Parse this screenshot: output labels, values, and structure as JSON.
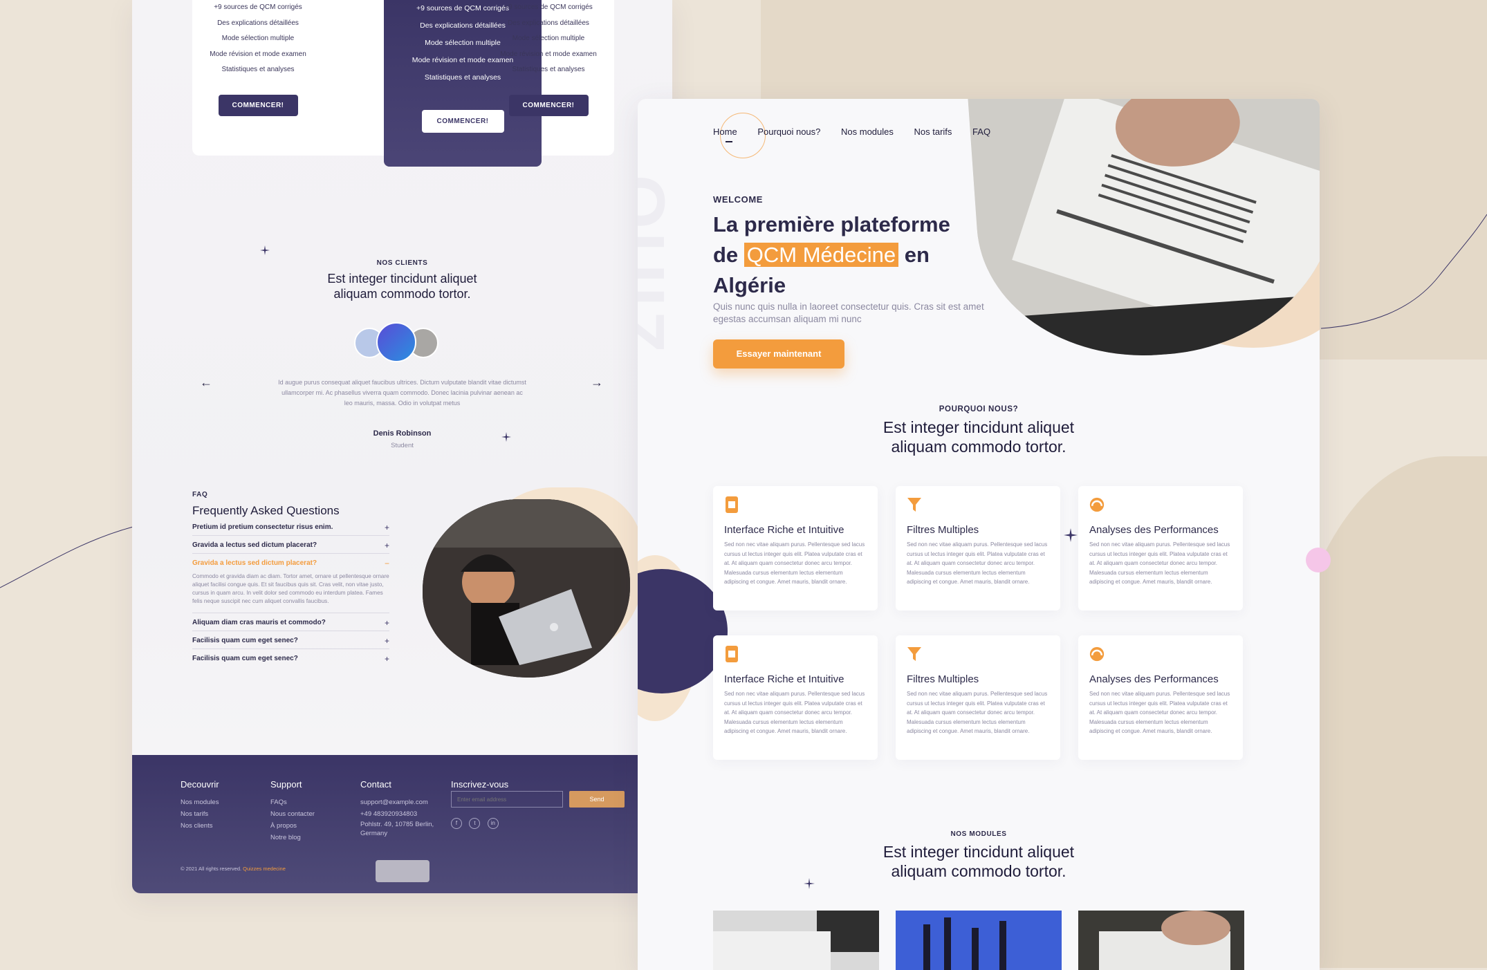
{
  "pricing": {
    "features": [
      "+9 sources de QCM corrigés",
      "Des explications détaillées",
      "Mode sélection multiple",
      "Mode révision et mode examen",
      "Statistiques et analyses"
    ],
    "button": "COMMENCER!"
  },
  "clients": {
    "eyebrow": "NOS CLIENTS",
    "title": "Est integer tincidunt aliquet aliquam commodo tortor.",
    "quote": "Id augue purus consequat aliquet faucibus ultrices. Dictum vulputate blandit vitae dictumst ullamcorper mi. Ac phasellus viverra quam commodo. Donec lacinia pulvinar aenean ac leo mauris, massa. Odio in volutpat metus",
    "author": "Denis Robinson",
    "role": "Student",
    "prev_arrow": "←",
    "next_arrow": "→"
  },
  "faq": {
    "eyebrow": "FAQ",
    "title": "Frequently Asked Questions",
    "items": [
      {
        "q": "Pretium id pretium consectetur risus enim.",
        "sign": "+"
      },
      {
        "q": "Gravida a lectus sed dictum placerat?",
        "sign": "+"
      },
      {
        "q": "Gravida a lectus sed dictum placerat?",
        "sign": "−",
        "a": "Commodo et gravida diam ac diam. Tortor amet, ornare ut pellentesque ornare aliquet facilisi congue quis. Et sit faucibus quis sit. Cras velit, non vitae justo, cursus in quam arcu. In velit dolor sed commodo eu interdum platea. Fames felis neque suscipit nec cum aliquet convallis faucibus."
      },
      {
        "q": "Aliquam diam cras mauris et commodo?",
        "sign": "+"
      },
      {
        "q": "Facilisis quam cum eget senec?",
        "sign": "+"
      },
      {
        "q": "Facilisis quam cum eget senec?",
        "sign": "+"
      }
    ]
  },
  "footer": {
    "decouvrir": {
      "title": "Decouvrir",
      "links": [
        "Nos modules",
        "Nos tarifs",
        "Nos clients"
      ]
    },
    "support": {
      "title": "Support",
      "links": [
        "FAQs",
        "Nous contacter",
        "À propos",
        "Notre blog"
      ]
    },
    "contact": {
      "title": "Contact",
      "email": "support@example.com",
      "phone": "+49 483920934803",
      "address": "Pohlstr. 49, 10785 Berlin, Germany"
    },
    "newsletter": {
      "title": "Inscrivez-vous",
      "placeholder": "Enter email address",
      "send": "Send"
    },
    "socials": [
      "f",
      "t",
      "in"
    ],
    "copyright": "© 2021 All rights reserved.",
    "brand": "Quizzes medecine"
  },
  "nav": {
    "items": [
      "Home",
      "Pourquoi nous?",
      "Nos modules",
      "Nos tarifs",
      "FAQ"
    ]
  },
  "hero": {
    "welcome": "WELCOME",
    "title_1": "La première plateforme",
    "title_2a": "de ",
    "title_highlight": "QCM Médecine",
    "title_2b": " en",
    "title_3": "Algérie",
    "subtitle": "Quis nunc quis nulla in laoreet consectetur quis. Cras sit est amet egestas accumsan aliquam mi nunc",
    "cta": "Essayer maintenant",
    "watermark": "QUIZ"
  },
  "pourquoi": {
    "eyebrow": "POURQUOI NOUS?",
    "title": "Est integer tincidunt aliquet aliquam commodo tortor.",
    "cards": [
      {
        "title": "Interface Riche et Intuitive",
        "text": "Sed non nec vitae aliquam purus. Pellentesque sed lacus cursus ut lectus integer quis elit. Platea vulputate cras et at. At aliquam quam consectetur donec arcu tempor. Malesuada cursus elementum lectus elementum adipiscing et congue. Amet mauris, blandit ornare."
      },
      {
        "title": "Filtres Multiples",
        "text": "Sed non nec vitae aliquam purus. Pellentesque sed lacus cursus ut lectus integer quis elit. Platea vulputate cras et at. At aliquam quam consectetur donec arcu tempor. Malesuada cursus elementum lectus elementum adipiscing et congue. Amet mauris, blandit ornare."
      },
      {
        "title": "Analyses des Performances",
        "text": "Sed non nec vitae aliquam purus. Pellentesque sed lacus cursus ut lectus integer quis elit. Platea vulputate cras et at. At aliquam quam consectetur donec arcu tempor. Malesuada cursus elementum lectus elementum adipiscing et congue. Amet mauris, blandit ornare."
      },
      {
        "title": "Interface Riche et Intuitive",
        "text": "Sed non nec vitae aliquam purus. Pellentesque sed lacus cursus ut lectus integer quis elit. Platea vulputate cras et at. At aliquam quam consectetur donec arcu tempor. Malesuada cursus elementum lectus elementum adipiscing et congue. Amet mauris, blandit ornare."
      },
      {
        "title": "Filtres Multiples",
        "text": "Sed non nec vitae aliquam purus. Pellentesque sed lacus cursus ut lectus integer quis elit. Platea vulputate cras et at. At aliquam quam consectetur donec arcu tempor. Malesuada cursus elementum lectus elementum adipiscing et congue. Amet mauris, blandit ornare."
      },
      {
        "title": "Analyses des Performances",
        "text": "Sed non nec vitae aliquam purus. Pellentesque sed lacus cursus ut lectus integer quis elit. Platea vulputate cras et at. At aliquam quam consectetur donec arcu tempor. Malesuada cursus elementum lectus elementum adipiscing et congue. Amet mauris, blandit ornare."
      }
    ]
  },
  "modules": {
    "eyebrow": "NOS MODULES",
    "title": "Est integer tincidunt aliquet aliquam commodo tortor."
  },
  "colors": {
    "primary": "#3b3566",
    "accent": "#f39c3d",
    "background": "#ece4d8"
  }
}
